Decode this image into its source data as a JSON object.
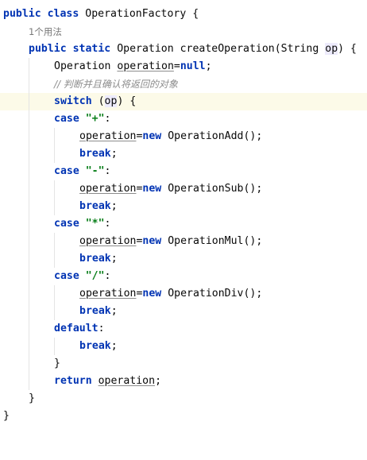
{
  "class_decl": {
    "kw_public": "public",
    "kw_class": "class",
    "name": "OperationFactory",
    "brace": "{"
  },
  "usage_hint": "1个用法",
  "method_decl": {
    "kw_public": "public",
    "kw_static": "static",
    "ret_type": "Operation",
    "name": "createOperation",
    "open": "(",
    "param_type": "String",
    "param_name": "op",
    "close": ")",
    "brace": "{"
  },
  "var_decl": {
    "type": "Operation",
    "name": "operation",
    "eq": "=",
    "value": "null",
    "semi": ";"
  },
  "comment": "// 判断并且确认将返回的对象",
  "switch_stmt": {
    "kw": "switch",
    "open": "(",
    "param": "op",
    "close": ")",
    "brace": "{"
  },
  "cases": [
    {
      "kw": "case",
      "value": "\"+\"",
      "colon": ":",
      "var": "operation",
      "eq": "=",
      "kw_new": "new",
      "ctor": "OperationAdd();",
      "kw_break": "break",
      "semi": ";"
    },
    {
      "kw": "case",
      "value": "\"-\"",
      "colon": ":",
      "var": "operation",
      "eq": "=",
      "kw_new": "new",
      "ctor": "OperationSub();",
      "kw_break": "break",
      "semi": ";"
    },
    {
      "kw": "case",
      "value": "\"*\"",
      "colon": ":",
      "var": "operation",
      "eq": "=",
      "kw_new": "new",
      "ctor": "OperationMul();",
      "kw_break": "break",
      "semi": ";"
    },
    {
      "kw": "case",
      "value": "\"/\"",
      "colon": ":",
      "var": "operation",
      "eq": "=",
      "kw_new": "new",
      "ctor": "OperationDiv();",
      "kw_break": "break",
      "semi": ";"
    }
  ],
  "default_stmt": {
    "kw": "default",
    "colon": ":",
    "kw_break": "break",
    "semi": ";"
  },
  "switch_close": "}",
  "return_stmt": {
    "kw": "return",
    "var": "operation",
    "semi": ";"
  },
  "method_close": "}",
  "class_close": "}"
}
